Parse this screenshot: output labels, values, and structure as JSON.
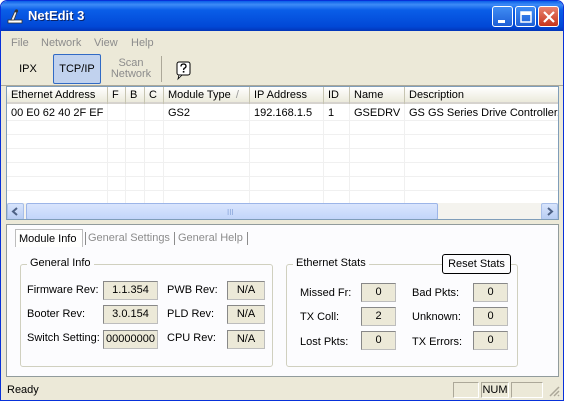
{
  "window": {
    "title": "NetEdit 3"
  },
  "menu": [
    "File",
    "Network",
    "View",
    "Help"
  ],
  "toolbar": {
    "ipx": "IPX",
    "tcpip": "TCP/IP",
    "scan_line1": "Scan",
    "scan_line2": "Network",
    "help_icon": "help-question-icon"
  },
  "table": {
    "columns": [
      "Ethernet Address",
      "F",
      "B",
      "C",
      "Module Type",
      "IP Address",
      "ID",
      "Name",
      "Description"
    ],
    "sort_indicator": "/",
    "rows": [
      [
        "00 E0 62 40 2F EF",
        "",
        "",
        "",
        "GS2",
        "192.168.1.5",
        "1",
        "GSEDRV",
        "GS GS Series Drive Controller."
      ]
    ],
    "scroll_grip": "III"
  },
  "tabs": [
    "Module Info",
    "General Settings",
    "General Help"
  ],
  "general_info": {
    "title": "General Info",
    "firmware_label": "Firmware Rev:",
    "firmware": "1.1.354",
    "booter_label": "Booter Rev:",
    "booter": "3.0.154",
    "switch_label": "Switch Setting:",
    "switch": "00000000",
    "pwb_label": "PWB Rev:",
    "pwb": "N/A",
    "pld_label": "PLD Rev:",
    "pld": "N/A",
    "cpu_label": "CPU Rev:",
    "cpu": "N/A"
  },
  "ethernet_stats": {
    "title": "Ethernet Stats",
    "reset_label": "Reset Stats",
    "missed_label": "Missed Fr:",
    "missed": "0",
    "txcoll_label": "TX Coll:",
    "txcoll": "2",
    "lost_label": "Lost Pkts:",
    "lost": "0",
    "bad_label": "Bad Pkts:",
    "bad": "0",
    "unknown_label": "Unknown:",
    "unknown": "0",
    "txerr_label": "TX Errors:",
    "txerr": "0"
  },
  "status": {
    "text": "Ready",
    "num": "NUM"
  }
}
